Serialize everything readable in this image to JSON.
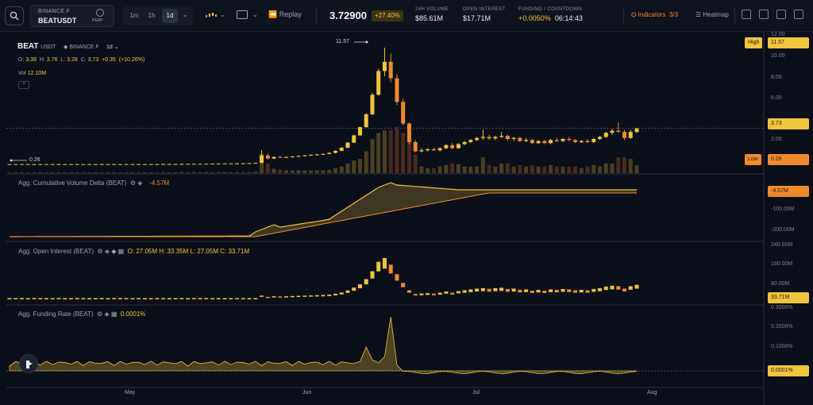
{
  "toolbar": {
    "exchange": "BINANCE.F",
    "symbol": "BEATUSDT",
    "contract": "PERP",
    "timeframes": [
      "1m",
      "1h",
      "1d"
    ],
    "active_timeframe": "1d",
    "replay": "Replay",
    "price": "3.72900",
    "change": "+27.40%",
    "stats": [
      {
        "label": "24H VOLUME",
        "value": "$85.61M"
      },
      {
        "label": "OPEN INTEREST",
        "value": "$17.71M"
      },
      {
        "label": "FUNDING / COUNTDOWN",
        "value": "+0.0050%",
        "value2": "06:14:43"
      }
    ],
    "indicators": "Indicators",
    "indicators_count": "3/3",
    "heatmap": "Heatmap"
  },
  "main": {
    "symbol": "BEAT",
    "symbol_quote": "USDT",
    "exchange": "BINANCE.F",
    "timeframe": "1d",
    "ohlc": {
      "o": "3.38",
      "h": "3.76",
      "l": "3.28",
      "c": "3.73",
      "chg": "+0.35",
      "pct": "(+10.26%)"
    },
    "vol_label": "Vol",
    "vol": "12.10M",
    "collapse": "^",
    "high_label": "High",
    "high_value": "11.57",
    "low_label": "Low",
    "low_value": "0.26",
    "last_value": "3.73",
    "min_label": "0.26",
    "max_label": "11.57",
    "axis": [
      "12.00",
      "10.00",
      "8.00",
      "6.00",
      "4.00",
      "2.00"
    ]
  },
  "cvd": {
    "title": "Agg. Cumulative Volume Delta (BEAT)",
    "value": "-4.57M",
    "axis": [
      "-100.00M",
      "-200.00M"
    ]
  },
  "oi": {
    "title": "Agg. Open Interest (BEAT)",
    "o": "27.05M",
    "h": "33.35M",
    "l": "27.05M",
    "c": "33.71M",
    "ohlc_text": "O: 27.05M  H: 33.35M  L: 27.05M  C: 33.71M",
    "value": "33.71M",
    "axis": [
      "240.00M",
      "160.00M",
      "80.00M"
    ]
  },
  "fr": {
    "title": "Agg. Funding Rate (BEAT)",
    "value": "0.0001%",
    "axis": [
      "0.3000%",
      "0.2000%",
      "0.1000%"
    ]
  },
  "time_axis": [
    "May",
    "Jun",
    "Jul",
    "Aug"
  ],
  "colors": {
    "up": "#f0c43d",
    "down": "#f08a2e",
    "bg": "#0b0f19",
    "grid": "#1c2230"
  },
  "chart_data": {
    "type": "candlestick",
    "x": [
      "2025-04-15",
      "2025-07-28"
    ],
    "candles": [
      [
        0.26,
        0.26,
        0.26,
        0.26
      ],
      [
        0.26,
        0.27,
        0.25,
        0.26
      ],
      [
        0.26,
        0.27,
        0.25,
        0.26
      ],
      [
        0.26,
        0.26,
        0.25,
        0.26
      ],
      [
        0.26,
        0.27,
        0.25,
        0.26
      ],
      [
        0.26,
        0.27,
        0.25,
        0.26
      ],
      [
        0.26,
        0.26,
        0.25,
        0.26
      ],
      [
        0.26,
        0.27,
        0.25,
        0.26
      ],
      [
        0.26,
        0.27,
        0.25,
        0.26
      ],
      [
        0.26,
        0.26,
        0.25,
        0.26
      ],
      [
        0.26,
        0.27,
        0.25,
        0.26
      ],
      [
        0.26,
        0.27,
        0.25,
        0.26
      ],
      [
        0.26,
        0.26,
        0.25,
        0.26
      ],
      [
        0.26,
        0.27,
        0.25,
        0.26
      ],
      [
        0.26,
        0.27,
        0.25,
        0.26
      ],
      [
        0.26,
        0.26,
        0.25,
        0.26
      ],
      [
        0.26,
        0.27,
        0.25,
        0.26
      ],
      [
        0.26,
        0.27,
        0.25,
        0.26
      ],
      [
        0.26,
        0.26,
        0.25,
        0.26
      ],
      [
        0.26,
        0.27,
        0.25,
        0.26
      ],
      [
        0.26,
        0.27,
        0.25,
        0.26
      ],
      [
        0.26,
        0.26,
        0.25,
        0.26
      ],
      [
        0.26,
        0.27,
        0.25,
        0.26
      ],
      [
        0.26,
        0.27,
        0.25,
        0.26
      ],
      [
        0.26,
        0.26,
        0.25,
        0.26
      ],
      [
        0.26,
        0.28,
        0.25,
        0.27
      ],
      [
        0.27,
        0.28,
        0.26,
        0.27
      ],
      [
        0.27,
        0.28,
        0.26,
        0.27
      ],
      [
        0.27,
        0.29,
        0.26,
        0.28
      ],
      [
        0.28,
        0.29,
        0.27,
        0.28
      ],
      [
        0.28,
        0.3,
        0.27,
        0.29
      ],
      [
        0.29,
        0.3,
        0.28,
        0.29
      ],
      [
        0.29,
        0.31,
        0.28,
        0.3
      ],
      [
        0.3,
        0.31,
        0.29,
        0.3
      ],
      [
        0.3,
        0.32,
        0.29,
        0.31
      ],
      [
        0.31,
        0.33,
        0.3,
        0.32
      ],
      [
        0.32,
        0.33,
        0.31,
        0.32
      ],
      [
        0.32,
        0.34,
        0.31,
        0.33
      ],
      [
        0.33,
        0.35,
        0.32,
        0.34
      ],
      [
        0.34,
        0.36,
        0.33,
        0.35
      ],
      [
        0.35,
        0.4,
        0.34,
        0.38
      ],
      [
        0.38,
        1.6,
        0.36,
        1.1
      ],
      [
        1.1,
        1.3,
        0.7,
        0.8
      ],
      [
        0.8,
        1.0,
        0.75,
        0.95
      ],
      [
        0.95,
        1.05,
        0.85,
        0.9
      ],
      [
        0.9,
        1.0,
        0.85,
        0.95
      ],
      [
        0.95,
        1.05,
        0.9,
        1.0
      ],
      [
        1.0,
        1.1,
        0.95,
        1.05
      ],
      [
        1.05,
        1.15,
        1.0,
        1.1
      ],
      [
        1.1,
        1.2,
        1.05,
        1.15
      ],
      [
        1.15,
        1.25,
        1.1,
        1.2
      ],
      [
        1.2,
        1.3,
        1.15,
        1.25
      ],
      [
        1.25,
        1.4,
        1.2,
        1.35
      ],
      [
        1.35,
        1.6,
        1.3,
        1.55
      ],
      [
        1.55,
        1.9,
        1.5,
        1.85
      ],
      [
        1.85,
        2.4,
        1.8,
        2.35
      ],
      [
        2.35,
        3.1,
        2.3,
        3.05
      ],
      [
        3.05,
        3.9,
        3.0,
        3.85
      ],
      [
        3.85,
        5.2,
        3.8,
        5.1
      ],
      [
        5.1,
        7.2,
        5.0,
        7.0
      ],
      [
        7.0,
        9.5,
        6.9,
        9.3
      ],
      [
        9.3,
        11.57,
        8.8,
        10.2
      ],
      [
        10.2,
        11.0,
        8.2,
        8.6
      ],
      [
        8.6,
        9.0,
        6.0,
        6.3
      ],
      [
        6.3,
        6.6,
        4.0,
        4.2
      ],
      [
        4.2,
        4.3,
        2.2,
        2.4
      ],
      [
        2.4,
        2.6,
        1.4,
        1.5
      ],
      [
        1.5,
        1.8,
        1.4,
        1.6
      ],
      [
        1.6,
        1.8,
        1.5,
        1.7
      ],
      [
        1.7,
        1.85,
        1.55,
        1.6
      ],
      [
        1.6,
        1.9,
        1.5,
        1.8
      ],
      [
        1.8,
        2.2,
        1.7,
        2.1
      ],
      [
        2.1,
        2.3,
        1.7,
        1.8
      ],
      [
        1.8,
        2.3,
        1.75,
        2.2
      ],
      [
        2.2,
        2.5,
        2.1,
        2.4
      ],
      [
        2.4,
        2.7,
        2.3,
        2.6
      ],
      [
        2.6,
        2.9,
        2.5,
        2.8
      ],
      [
        2.8,
        3.6,
        2.6,
        2.9
      ],
      [
        2.9,
        3.1,
        2.6,
        2.75
      ],
      [
        2.75,
        3.0,
        2.6,
        2.9
      ],
      [
        2.9,
        3.4,
        2.8,
        3.0
      ],
      [
        3.0,
        3.1,
        2.5,
        2.7
      ],
      [
        2.7,
        2.9,
        2.5,
        2.8
      ],
      [
        2.8,
        2.9,
        2.4,
        2.5
      ],
      [
        2.5,
        2.8,
        2.4,
        2.6
      ],
      [
        2.6,
        2.7,
        2.2,
        2.3
      ],
      [
        2.3,
        2.6,
        2.2,
        2.5
      ],
      [
        2.5,
        2.6,
        2.2,
        2.3
      ],
      [
        2.3,
        2.7,
        2.2,
        2.6
      ],
      [
        2.6,
        2.8,
        2.4,
        2.5
      ],
      [
        2.5,
        2.8,
        2.4,
        2.7
      ],
      [
        2.7,
        2.9,
        2.5,
        2.6
      ],
      [
        2.6,
        2.7,
        2.3,
        2.4
      ],
      [
        2.4,
        2.6,
        2.3,
        2.5
      ],
      [
        2.5,
        2.7,
        2.3,
        2.4
      ],
      [
        2.4,
        2.8,
        2.3,
        2.7
      ],
      [
        2.7,
        3.0,
        2.6,
        2.9
      ],
      [
        2.9,
        3.4,
        2.8,
        3.3
      ],
      [
        3.3,
        3.7,
        3.1,
        3.5
      ],
      [
        3.5,
        4.3,
        3.3,
        3.4
      ],
      [
        3.4,
        3.6,
        2.6,
        2.8
      ],
      [
        2.8,
        3.6,
        2.7,
        3.38
      ],
      [
        3.38,
        3.76,
        3.28,
        3.73
      ]
    ],
    "high": 11.57,
    "low": 0.26,
    "ylim": [
      0,
      12.5
    ]
  }
}
